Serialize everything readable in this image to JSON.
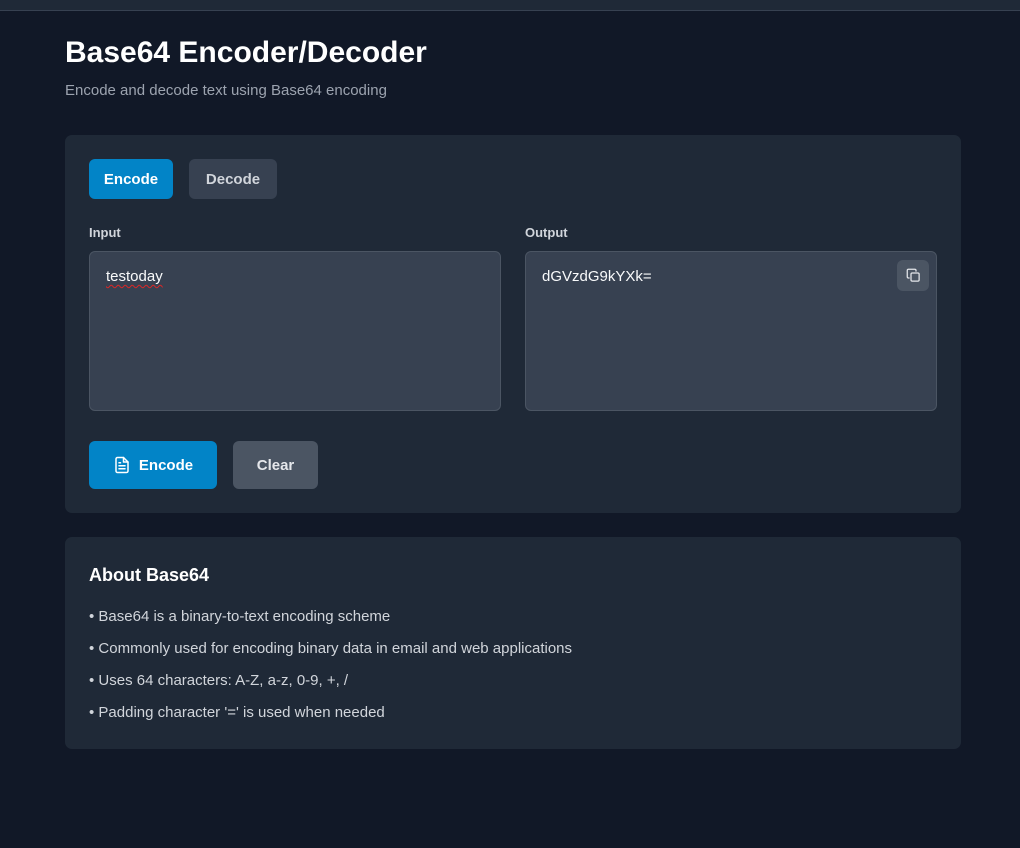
{
  "header": {
    "title": "Base64 Encoder/Decoder",
    "subtitle": "Encode and decode text using Base64 encoding"
  },
  "mode_tabs": {
    "encode_label": "Encode",
    "decode_label": "Decode",
    "active": "Encode"
  },
  "input": {
    "label": "Input",
    "value": "testoday"
  },
  "output": {
    "label": "Output",
    "value": "dGVzdG9kYXk="
  },
  "actions": {
    "encode_label": "Encode",
    "clear_label": "Clear"
  },
  "about": {
    "title": "About Base64",
    "items": [
      "• Base64 is a binary-to-text encoding scheme",
      "• Commonly used for encoding binary data in email and web applications",
      "• Uses 64 characters: A-Z, a-z, 0-9, +, /",
      "• Padding character '=' is used when needed"
    ]
  },
  "icons": {
    "copy": "copy-icon",
    "document": "document-icon"
  },
  "colors": {
    "accent": "#0284c7",
    "background": "#111827",
    "card": "#1f2937",
    "field": "#374151"
  }
}
